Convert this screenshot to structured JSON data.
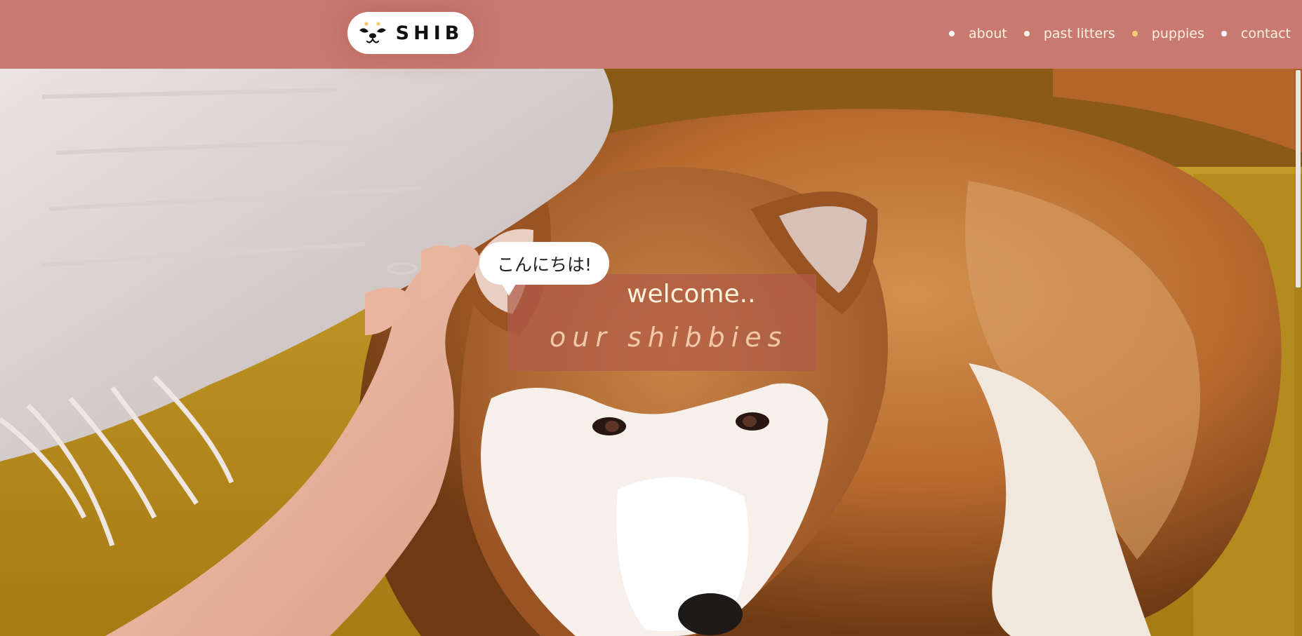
{
  "header": {
    "logo_text": "SHIB",
    "nav": [
      {
        "label": "about",
        "dot_color": "#ffffff"
      },
      {
        "label": "past litters",
        "dot_color": "#fbf3e0"
      },
      {
        "label": "puppies",
        "dot_color": "#f7cf7c"
      },
      {
        "label": "contact",
        "dot_color": "#ffffff"
      }
    ]
  },
  "hero": {
    "bubble": "こんにちは!",
    "title": "welcome..",
    "subtitle": "our shibbies"
  },
  "colors": {
    "header_bg": "#c97a70",
    "title_box": "#b05c48",
    "nav_text": "#fdf2e2",
    "subtitle": "#f2c9a6"
  },
  "icons": {
    "logo": "shiba-face-icon"
  }
}
